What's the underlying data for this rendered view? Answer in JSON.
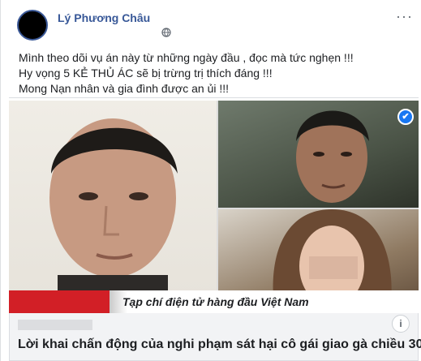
{
  "post": {
    "author": "Lý Phương Châu",
    "more_label": "···",
    "lines": [
      "Mình theo dõi vụ án này từ những ngày đầu , đọc mà tức nghẹn !!!",
      "Hy vọng 5 KẺ THỦ ÁC sẽ bị trừng trị thích đáng !!!",
      "Mong Nạn nhân và gia đình được an ủi !!!"
    ]
  },
  "media": {
    "banner_text": "Tạp chí điện tử hàng đầu Việt Nam",
    "verify_glyph": "✔"
  },
  "link": {
    "info_glyph": "i",
    "headline": "Lời khai chấn động của nghi phạm sát hại cô gái giao gà chiều 30"
  },
  "icons": {
    "avatar": "avatar",
    "globe": "globe-icon",
    "more": "more-options-icon",
    "verify": "verified-check-icon",
    "info": "info-icon"
  },
  "colors": {
    "author": "#385898",
    "banner_red": "#d21f26",
    "verify_blue": "#1877f2"
  }
}
